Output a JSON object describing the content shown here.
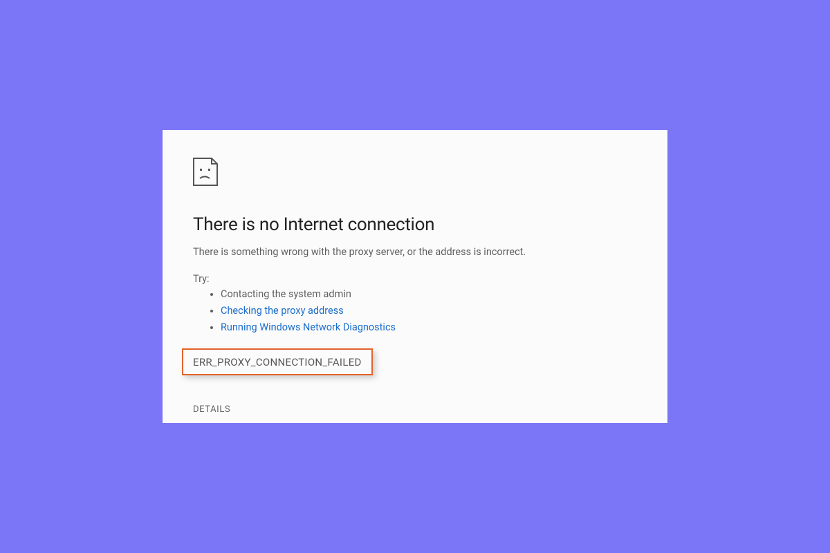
{
  "title": "There is no Internet connection",
  "subtitle": "There is something wrong with the proxy server, or the address is incorrect.",
  "try_label": "Try:",
  "suggestions": {
    "item0": "Contacting the system admin",
    "item1": "Checking the proxy address",
    "item2": "Running Windows Network Diagnostics"
  },
  "error_code": "ERR_PROXY_CONNECTION_FAILED",
  "details_label": "DETAILS"
}
